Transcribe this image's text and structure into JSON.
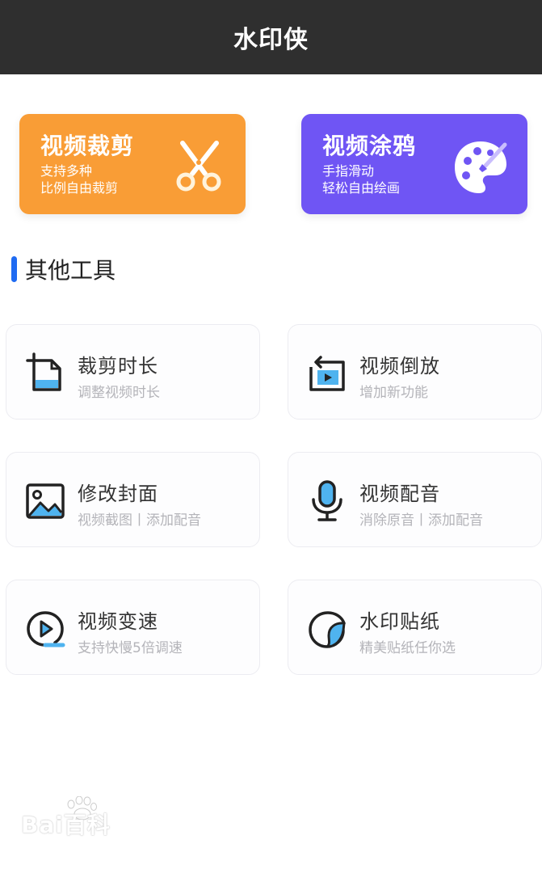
{
  "app": {
    "title": "水印侠"
  },
  "promos": {
    "clip": {
      "title": "视频裁剪",
      "line1": "支持多种",
      "line2": "比例自由裁剪",
      "icon": "scissors-icon",
      "color": "#f99d36"
    },
    "doodle": {
      "title": "视频涂鸦",
      "line1": "手指滑动",
      "line2": "轻松自由绘画",
      "icon": "palette-icon",
      "color": "#6f55f4"
    }
  },
  "section": {
    "title": "其他工具",
    "accent": "#1f6bf2"
  },
  "tools": [
    {
      "name": "裁剪时长",
      "desc": "调整视频时长",
      "icon": "trim-duration-icon"
    },
    {
      "name": "视频倒放",
      "desc": "增加新功能",
      "icon": "reverse-play-icon"
    },
    {
      "name": "修改封面",
      "desc": "视频截图丨添加配音",
      "icon": "cover-image-icon"
    },
    {
      "name": "视频配音",
      "desc": "消除原音丨添加配音",
      "icon": "microphone-icon"
    },
    {
      "name": "视频变速",
      "desc": "支持快慢5倍调速",
      "icon": "speed-play-icon"
    },
    {
      "name": "水印贴纸",
      "desc": "精美贴纸任你选",
      "icon": "sticker-icon"
    }
  ],
  "watermark": {
    "text": "Bai百科"
  }
}
